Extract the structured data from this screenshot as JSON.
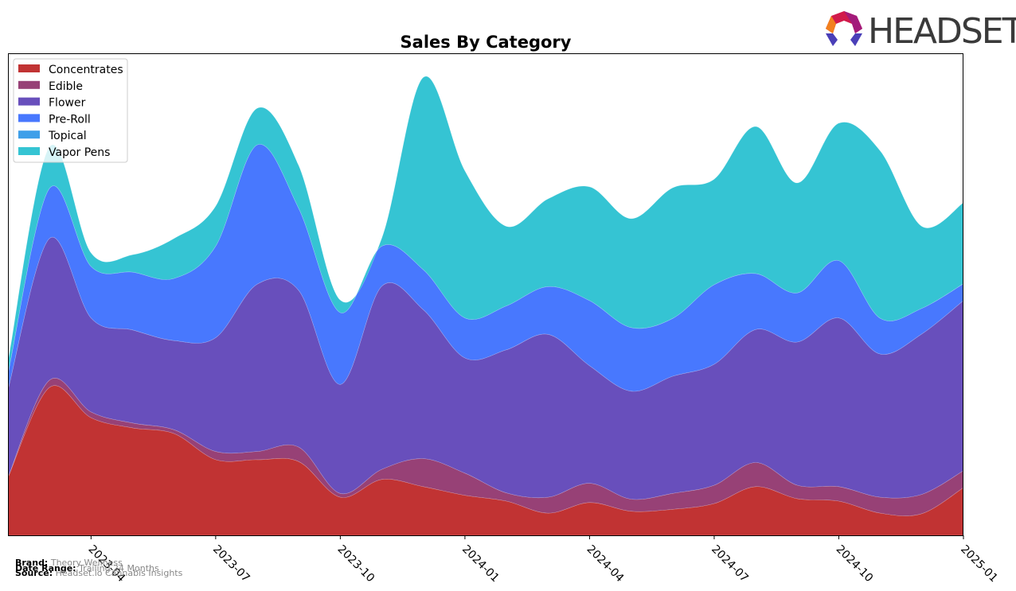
{
  "logo": {
    "text": "HEADSET"
  },
  "footer": {
    "brand_label": "Brand:",
    "brand_value": "Theory Wellness",
    "date_range_label": "Date Range:",
    "date_range_value": "Trailing 24 Months",
    "source_label": "Source:",
    "source_value": "Headset.io Cannabis Insights"
  },
  "chart_data": {
    "type": "area",
    "stacked": true,
    "smooth": true,
    "title": "Sales By Category",
    "xlabel": "",
    "ylabel": "",
    "ylim": [
      0,
      100
    ],
    "y_units": "relative sales (no y-axis ticks shown)",
    "grid": false,
    "legend_position": "top-left",
    "x": [
      "2023-02",
      "2023-03",
      "2023-04",
      "2023-05",
      "2023-06",
      "2023-07",
      "2023-08",
      "2023-09",
      "2023-10",
      "2023-11",
      "2023-12",
      "2024-01",
      "2024-02",
      "2024-03",
      "2024-04",
      "2024-05",
      "2024-06",
      "2024-07",
      "2024-08",
      "2024-09",
      "2024-10",
      "2024-11",
      "2024-12",
      "2025-01"
    ],
    "x_ticks": [
      "2023-04",
      "2023-07",
      "2023-10",
      "2024-01",
      "2024-04",
      "2024-07",
      "2024-10",
      "2025-01"
    ],
    "series": [
      {
        "name": "Concentrates",
        "color": "#c13333",
        "values": [
          12.0,
          30.7,
          24.4,
          22.3,
          21.1,
          15.7,
          15.7,
          15.3,
          7.9,
          11.6,
          10.1,
          8.3,
          7.1,
          4.6,
          6.8,
          5.0,
          5.4,
          6.6,
          10.1,
          7.6,
          7.1,
          4.6,
          4.5,
          9.9
        ]
      },
      {
        "name": "Edible",
        "color": "#974176",
        "values": [
          0.0,
          1.5,
          1.2,
          1.0,
          0.8,
          1.7,
          1.7,
          3.0,
          0.8,
          2.1,
          5.8,
          4.6,
          1.7,
          3.3,
          4.0,
          2.5,
          3.3,
          3.8,
          5.0,
          2.8,
          3.0,
          3.3,
          4.0,
          3.5
        ]
      },
      {
        "name": "Flower",
        "color": "#684fbc",
        "values": [
          18.2,
          29.4,
          19.5,
          19.3,
          18.5,
          23.6,
          34.7,
          32.5,
          22.6,
          38.0,
          30.9,
          23.9,
          29.7,
          33.8,
          24.4,
          22.4,
          24.3,
          25.1,
          27.6,
          29.7,
          35.0,
          29.7,
          33.3,
          35.3
        ]
      },
      {
        "name": "Pre-Roll",
        "color": "#4878fe",
        "values": [
          3.3,
          10.4,
          10.7,
          12.0,
          12.9,
          19.0,
          28.9,
          17.0,
          14.9,
          8.3,
          8.3,
          8.3,
          9.1,
          9.9,
          13.5,
          13.2,
          12.0,
          16.5,
          11.6,
          10.2,
          11.9,
          7.4,
          5.3,
          3.5
        ]
      },
      {
        "name": "Topical",
        "color": "#3e9fe9",
        "values": [
          0,
          0,
          0,
          0,
          0,
          0,
          0,
          0,
          0,
          0,
          0,
          0,
          0,
          0,
          0,
          0,
          0,
          0,
          0,
          0,
          0,
          0,
          0,
          0
        ]
      },
      {
        "name": "Vapor Pens",
        "color": "#35c4d3",
        "values": [
          2.5,
          8.6,
          2.8,
          3.6,
          8.3,
          8.3,
          7.6,
          8.9,
          2.6,
          1.7,
          39.9,
          30.5,
          16.5,
          18.2,
          23.6,
          22.6,
          27.1,
          21.9,
          30.5,
          22.8,
          28.5,
          34.7,
          17.0,
          16.8
        ]
      }
    ]
  }
}
